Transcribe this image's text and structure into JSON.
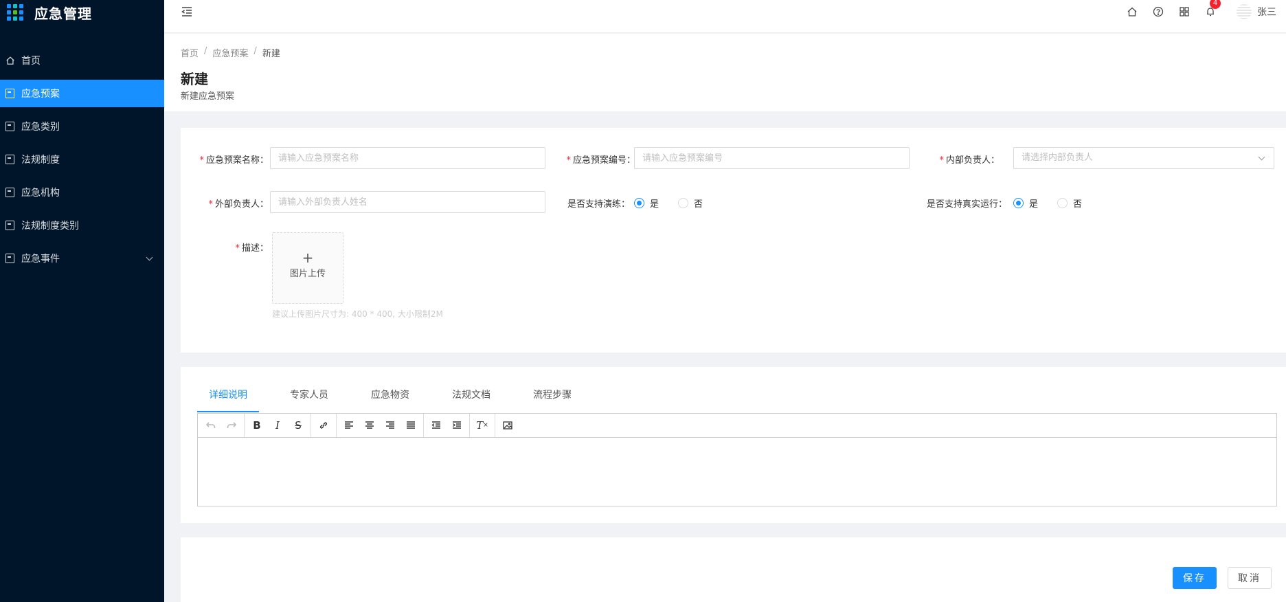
{
  "app": {
    "title": "应急管理"
  },
  "sidebar": {
    "items": [
      {
        "label": "首页",
        "icon": "home-icon"
      },
      {
        "label": "应急预案",
        "icon": "document-icon",
        "active": true
      },
      {
        "label": "应急类别",
        "icon": "document-icon"
      },
      {
        "label": "法规制度",
        "icon": "document-icon"
      },
      {
        "label": "应急机构",
        "icon": "document-icon"
      },
      {
        "label": "法规制度类别",
        "icon": "document-icon"
      },
      {
        "label": "应急事件",
        "icon": "document-icon",
        "expandable": true
      }
    ]
  },
  "header": {
    "notification_count": "4",
    "username": "张三"
  },
  "breadcrumb": [
    "首页",
    "应急预案",
    "新建"
  ],
  "page": {
    "title": "新建",
    "subtitle": "新建应急预案"
  },
  "form": {
    "plan_name": {
      "label": "应急预案名称",
      "placeholder": "请输入应急预案名称"
    },
    "plan_code": {
      "label": "应急预案编号",
      "placeholder": "请输入应急预案编号"
    },
    "internal_owner": {
      "label": "内部负责人",
      "placeholder": "请选择内部负责人"
    },
    "external_owner": {
      "label": "外部负责人",
      "placeholder": "请输入外部负责人姓名"
    },
    "support_drill": {
      "label": "是否支持演练",
      "yes": "是",
      "no": "否",
      "value": "是"
    },
    "support_real_run": {
      "label": "是否支持真实运行",
      "yes": "是",
      "no": "否",
      "value": "是"
    },
    "description": {
      "label": "描述",
      "upload_plus": "+",
      "upload_text": "图片上传",
      "hint": "建议上传图片尺寸为: 400 * 400, 大小限制2M"
    },
    "colon": "："
  },
  "tabs": [
    {
      "label": "详细说明",
      "active": true
    },
    {
      "label": "专家人员"
    },
    {
      "label": "应急物资"
    },
    {
      "label": "法规文档"
    },
    {
      "label": "流程步骤"
    }
  ],
  "editor": {
    "toolbar": [
      "undo",
      "redo",
      "bold",
      "italic",
      "strikethrough",
      "link",
      "align-left",
      "align-center",
      "align-right",
      "align-justify",
      "outdent",
      "indent",
      "clear-format",
      "image"
    ],
    "bold_glyph": "B",
    "italic_glyph": "I",
    "strike_glyph": "S",
    "clear_glyph": "T"
  },
  "actions": {
    "save": "保存",
    "cancel": "取消"
  },
  "colors": {
    "primary": "#1890ff",
    "sidebar_bg": "#001529",
    "required": "#f5222d"
  }
}
